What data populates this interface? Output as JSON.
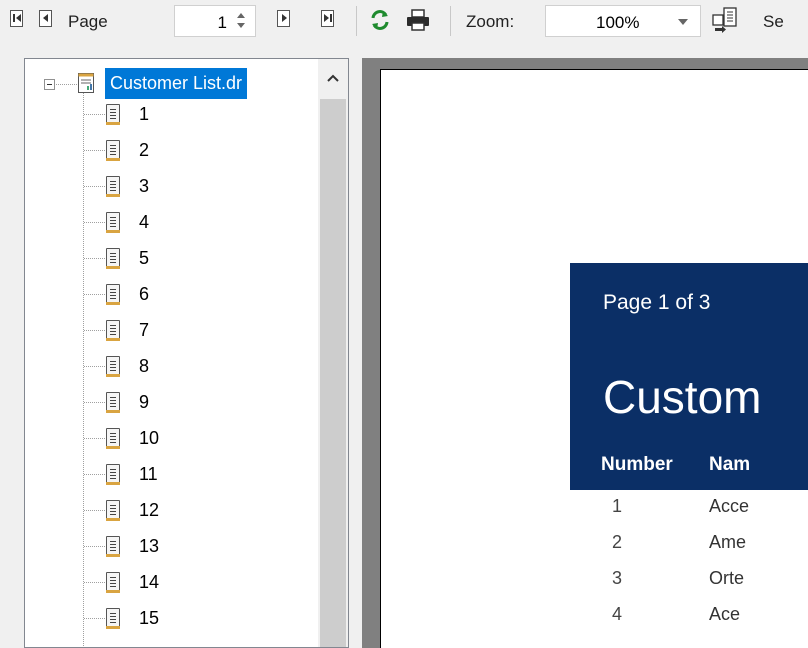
{
  "toolbar": {
    "page_label": "Page",
    "page_value": "1",
    "zoom_label": "Zoom:",
    "zoom_value": "100%",
    "setup_label": "Se",
    "icons": [
      "first-page-icon",
      "previous-page-icon",
      "next-page-icon",
      "last-page-icon",
      "refresh-icon",
      "print-icon",
      "export-icon"
    ]
  },
  "outline": {
    "root_label": "Customer List.dr",
    "items": [
      "1",
      "2",
      "3",
      "4",
      "5",
      "6",
      "7",
      "8",
      "9",
      "10",
      "11",
      "12",
      "13",
      "14",
      "15"
    ]
  },
  "report": {
    "page_counter": "Page 1 of 3",
    "title": "Custom",
    "columns": [
      "Number",
      "Nam"
    ],
    "rows": [
      {
        "number": "1",
        "name": "Acce"
      },
      {
        "number": "2",
        "name": "Ame"
      },
      {
        "number": "3",
        "name": "Orte"
      },
      {
        "number": "4",
        "name": "Ace"
      }
    ]
  },
  "colors": {
    "selection": "#0078d7",
    "report_header": "#0b2f66",
    "preview_background": "#808080"
  }
}
